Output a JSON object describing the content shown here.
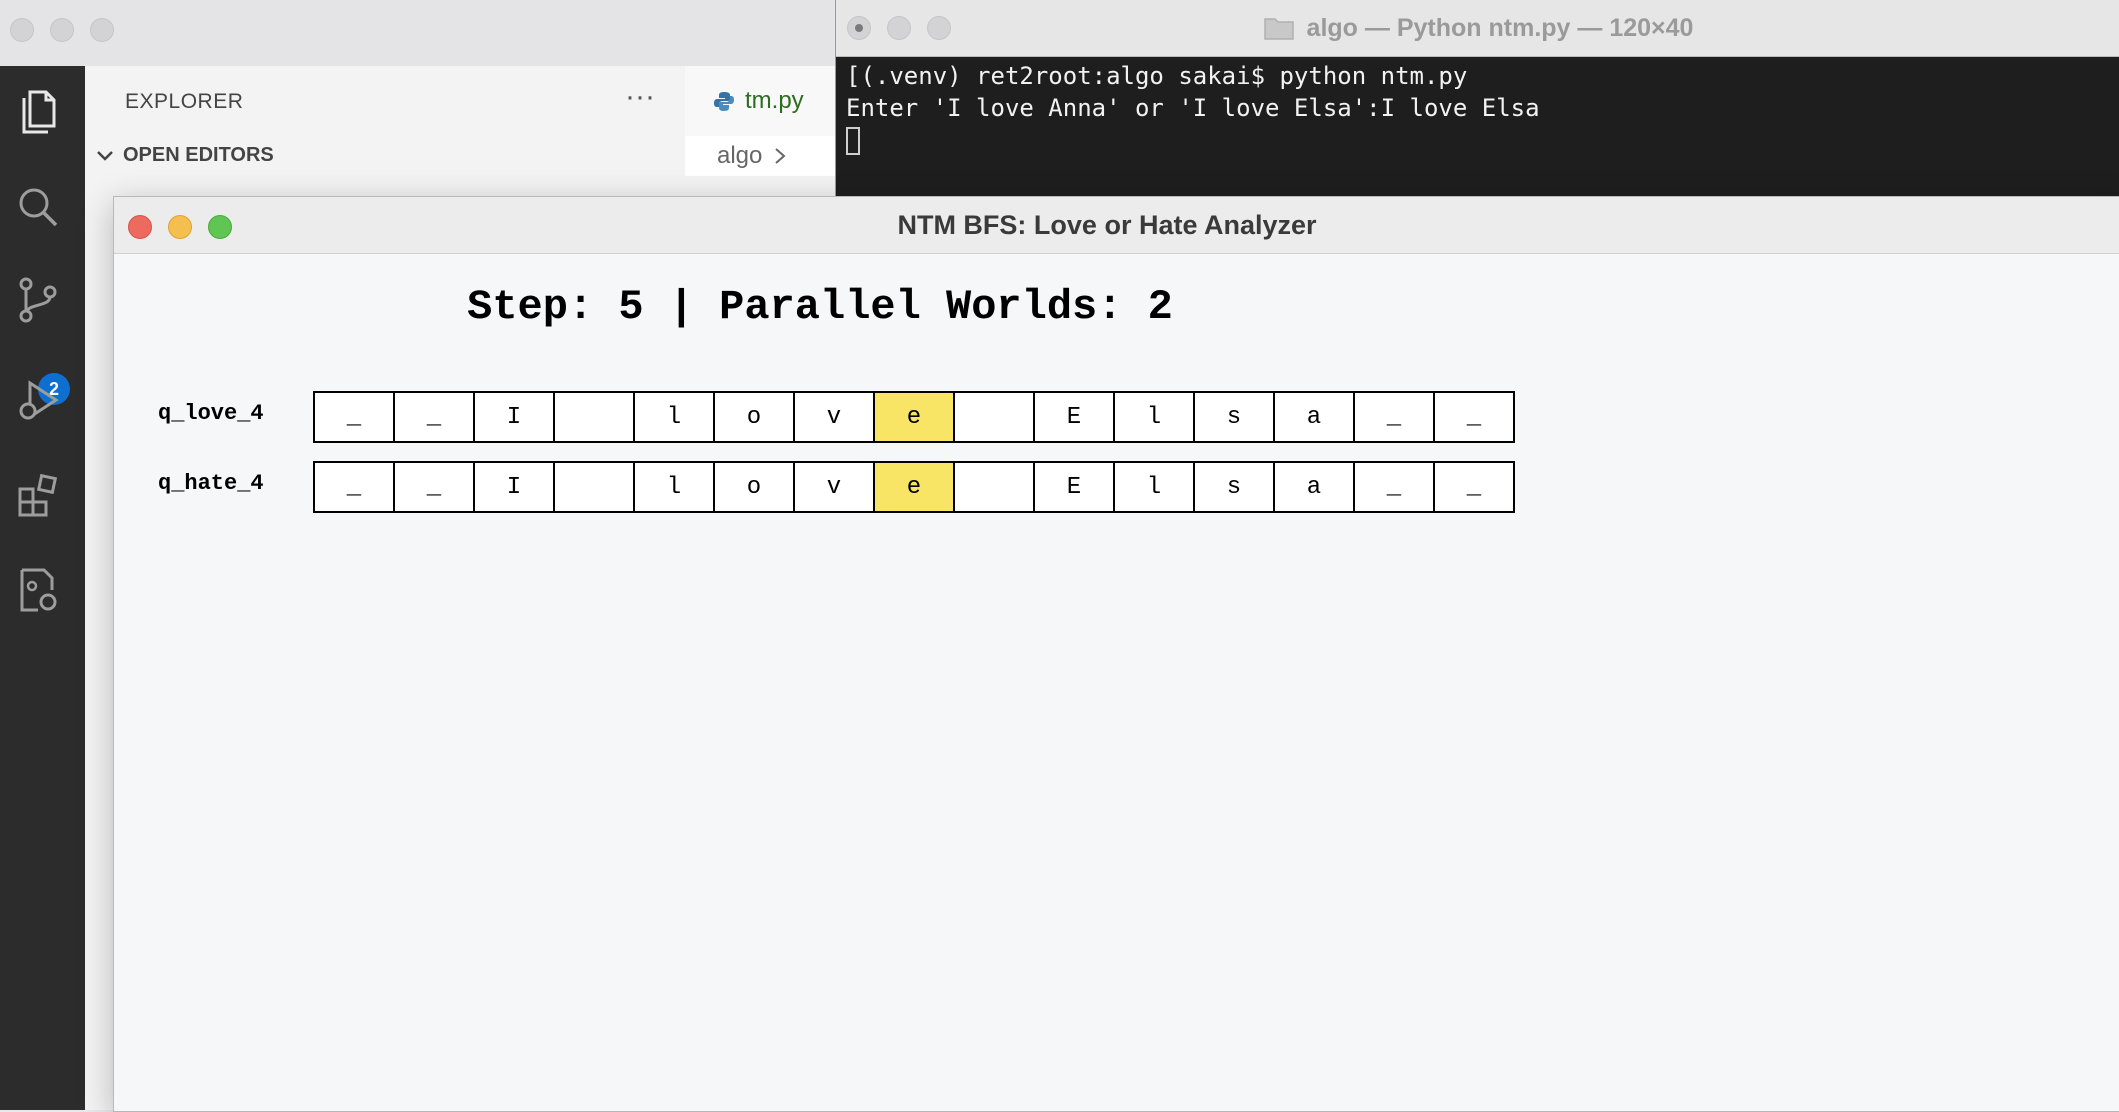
{
  "vscode": {
    "explorer_title": "EXPLORER",
    "more_label": "···",
    "open_editors_label": "OPEN EDITORS",
    "tab_label": "tm.py",
    "breadcrumb_folder": "algo",
    "scm_badge": "2",
    "activity_icons": [
      "files-icon",
      "search-icon",
      "source-control-icon",
      "run-debug-icon",
      "extensions-icon",
      "remote-explorer-icon"
    ]
  },
  "terminal": {
    "title": "algo — Python ntm.py — 120×40",
    "lines": [
      "[(.venv) ret2root:algo sakai$ python ntm.py",
      "Enter 'I love Anna' or 'I love Elsa':I love Elsa"
    ]
  },
  "app": {
    "title": "NTM BFS: Love or Hate Analyzer",
    "step_line": "Step: 5 | Parallel Worlds: 2",
    "tapes": [
      {
        "state": "q_love_4",
        "cells": [
          "_",
          "_",
          "I",
          "",
          "l",
          "o",
          "v",
          "e",
          "",
          "E",
          "l",
          "s",
          "a",
          "_",
          "_"
        ],
        "head_index": 7
      },
      {
        "state": "q_hate_4",
        "cells": [
          "_",
          "_",
          "I",
          "",
          "l",
          "o",
          "v",
          "e",
          "",
          "E",
          "l",
          "s",
          "a",
          "_",
          "_"
        ],
        "head_index": 7
      }
    ],
    "head_color": "#f8e465"
  },
  "colors": {
    "close": "#ed6a5e",
    "minimize": "#f5bf4f",
    "zoom": "#61c554",
    "terminal_bg": "#1e1e1e",
    "activity_bar": "#2c2c2c",
    "badge": "#0e6fd1"
  }
}
